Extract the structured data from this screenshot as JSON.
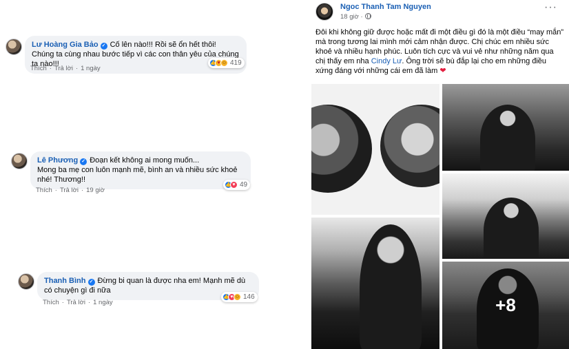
{
  "comments": [
    {
      "author": "Lư Hoàng Gia Bảo",
      "text": "Cố lên nào!!! Rồi sẽ ổn hết thôi! Chúng ta cùng nhau bước tiếp vì các con thân yêu của chúng ta nào!!!",
      "like_label": "Thích",
      "reply_label": "Trả lời",
      "time": "1 ngày",
      "reaction_count": "419"
    },
    {
      "author": "Lê Phương",
      "text": "Đoạn kết không ai mong muốn...",
      "text2": "Mong ba mẹ con luôn mạnh mẽ, bình an và nhiều sức khoẻ nhé! Thương!!",
      "like_label": "Thích",
      "reply_label": "Trả lời",
      "time": "19 giờ",
      "reaction_count": "49"
    },
    {
      "author": "Thanh Bình",
      "text": "Đừng bi quan là được nha em! Mạnh mẽ dù có chuyện gì đi nữa",
      "like_label": "Thích",
      "reply_label": "Trả lời",
      "time": "1 ngày",
      "reaction_count": "146"
    }
  ],
  "post": {
    "author": "Ngoc Thanh Tam Nguyen",
    "time": "18 giờ",
    "more": "···",
    "text_before": "Đôi khi không giữ được hoặc mất đi một điều gì đó là một điều “may mắn” mà trong tương lai mình mới cảm nhận được. Chị chúc em nhiều sức khoẻ và nhiều hạnh phúc. Luôn tích cực và vui vẻ như những năm qua chị thấy em nha ",
    "mention": "Cindy Lư",
    "text_after": ". Ông trời sẽ bù đắp lại cho em những điều xứng đáng với những cái em đã làm ",
    "heart": "❤",
    "extra_photos": "+8"
  },
  "colors": {
    "link_blue": "#1a5fb4",
    "bubble_bg": "#f0f2f5",
    "meta_gray": "#65676b",
    "like_blue": "#1877f2",
    "love_red": "#f33e58"
  }
}
